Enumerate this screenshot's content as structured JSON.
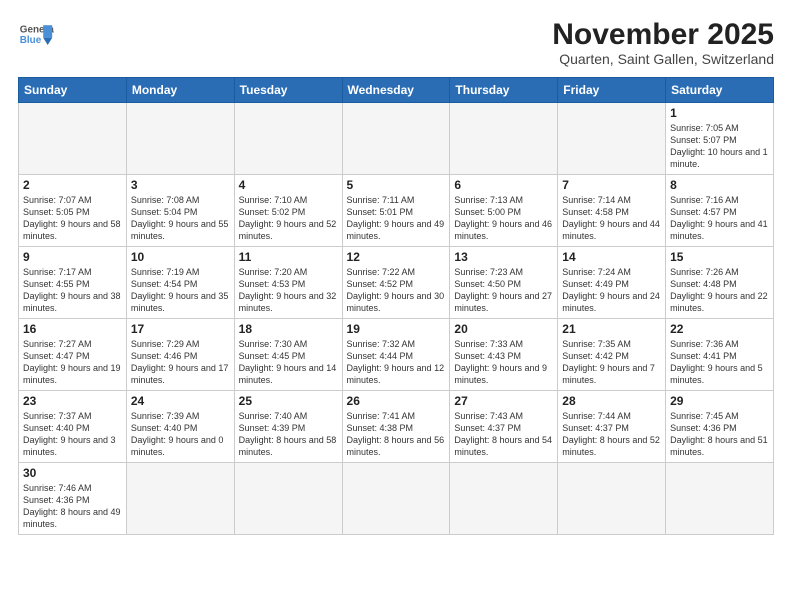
{
  "header": {
    "logo_general": "General",
    "logo_blue": "Blue",
    "month_title": "November 2025",
    "subtitle": "Quarten, Saint Gallen, Switzerland"
  },
  "weekdays": [
    "Sunday",
    "Monday",
    "Tuesday",
    "Wednesday",
    "Thursday",
    "Friday",
    "Saturday"
  ],
  "weeks": [
    [
      {
        "day": "",
        "empty": true
      },
      {
        "day": "",
        "empty": true
      },
      {
        "day": "",
        "empty": true
      },
      {
        "day": "",
        "empty": true
      },
      {
        "day": "",
        "empty": true
      },
      {
        "day": "",
        "empty": true
      },
      {
        "day": "1",
        "sunrise": "7:05 AM",
        "sunset": "5:07 PM",
        "daylight": "10 hours and 1 minute."
      }
    ],
    [
      {
        "day": "2",
        "sunrise": "7:07 AM",
        "sunset": "5:05 PM",
        "daylight": "9 hours and 58 minutes."
      },
      {
        "day": "3",
        "sunrise": "7:08 AM",
        "sunset": "5:04 PM",
        "daylight": "9 hours and 55 minutes."
      },
      {
        "day": "4",
        "sunrise": "7:10 AM",
        "sunset": "5:02 PM",
        "daylight": "9 hours and 52 minutes."
      },
      {
        "day": "5",
        "sunrise": "7:11 AM",
        "sunset": "5:01 PM",
        "daylight": "9 hours and 49 minutes."
      },
      {
        "day": "6",
        "sunrise": "7:13 AM",
        "sunset": "5:00 PM",
        "daylight": "9 hours and 46 minutes."
      },
      {
        "day": "7",
        "sunrise": "7:14 AM",
        "sunset": "4:58 PM",
        "daylight": "9 hours and 44 minutes."
      },
      {
        "day": "8",
        "sunrise": "7:16 AM",
        "sunset": "4:57 PM",
        "daylight": "9 hours and 41 minutes."
      }
    ],
    [
      {
        "day": "9",
        "sunrise": "7:17 AM",
        "sunset": "4:55 PM",
        "daylight": "9 hours and 38 minutes."
      },
      {
        "day": "10",
        "sunrise": "7:19 AM",
        "sunset": "4:54 PM",
        "daylight": "9 hours and 35 minutes."
      },
      {
        "day": "11",
        "sunrise": "7:20 AM",
        "sunset": "4:53 PM",
        "daylight": "9 hours and 32 minutes."
      },
      {
        "day": "12",
        "sunrise": "7:22 AM",
        "sunset": "4:52 PM",
        "daylight": "9 hours and 30 minutes."
      },
      {
        "day": "13",
        "sunrise": "7:23 AM",
        "sunset": "4:50 PM",
        "daylight": "9 hours and 27 minutes."
      },
      {
        "day": "14",
        "sunrise": "7:24 AM",
        "sunset": "4:49 PM",
        "daylight": "9 hours and 24 minutes."
      },
      {
        "day": "15",
        "sunrise": "7:26 AM",
        "sunset": "4:48 PM",
        "daylight": "9 hours and 22 minutes."
      }
    ],
    [
      {
        "day": "16",
        "sunrise": "7:27 AM",
        "sunset": "4:47 PM",
        "daylight": "9 hours and 19 minutes."
      },
      {
        "day": "17",
        "sunrise": "7:29 AM",
        "sunset": "4:46 PM",
        "daylight": "9 hours and 17 minutes."
      },
      {
        "day": "18",
        "sunrise": "7:30 AM",
        "sunset": "4:45 PM",
        "daylight": "9 hours and 14 minutes."
      },
      {
        "day": "19",
        "sunrise": "7:32 AM",
        "sunset": "4:44 PM",
        "daylight": "9 hours and 12 minutes."
      },
      {
        "day": "20",
        "sunrise": "7:33 AM",
        "sunset": "4:43 PM",
        "daylight": "9 hours and 9 minutes."
      },
      {
        "day": "21",
        "sunrise": "7:35 AM",
        "sunset": "4:42 PM",
        "daylight": "9 hours and 7 minutes."
      },
      {
        "day": "22",
        "sunrise": "7:36 AM",
        "sunset": "4:41 PM",
        "daylight": "9 hours and 5 minutes."
      }
    ],
    [
      {
        "day": "23",
        "sunrise": "7:37 AM",
        "sunset": "4:40 PM",
        "daylight": "9 hours and 3 minutes."
      },
      {
        "day": "24",
        "sunrise": "7:39 AM",
        "sunset": "4:40 PM",
        "daylight": "9 hours and 0 minutes."
      },
      {
        "day": "25",
        "sunrise": "7:40 AM",
        "sunset": "4:39 PM",
        "daylight": "8 hours and 58 minutes."
      },
      {
        "day": "26",
        "sunrise": "7:41 AM",
        "sunset": "4:38 PM",
        "daylight": "8 hours and 56 minutes."
      },
      {
        "day": "27",
        "sunrise": "7:43 AM",
        "sunset": "4:37 PM",
        "daylight": "8 hours and 54 minutes."
      },
      {
        "day": "28",
        "sunrise": "7:44 AM",
        "sunset": "4:37 PM",
        "daylight": "8 hours and 52 minutes."
      },
      {
        "day": "29",
        "sunrise": "7:45 AM",
        "sunset": "4:36 PM",
        "daylight": "8 hours and 51 minutes."
      }
    ],
    [
      {
        "day": "30",
        "sunrise": "7:46 AM",
        "sunset": "4:36 PM",
        "daylight": "8 hours and 49 minutes.",
        "last": true
      },
      {
        "day": "",
        "empty": true,
        "last": true
      },
      {
        "day": "",
        "empty": true,
        "last": true
      },
      {
        "day": "",
        "empty": true,
        "last": true
      },
      {
        "day": "",
        "empty": true,
        "last": true
      },
      {
        "day": "",
        "empty": true,
        "last": true
      },
      {
        "day": "",
        "empty": true,
        "last": true
      }
    ]
  ]
}
